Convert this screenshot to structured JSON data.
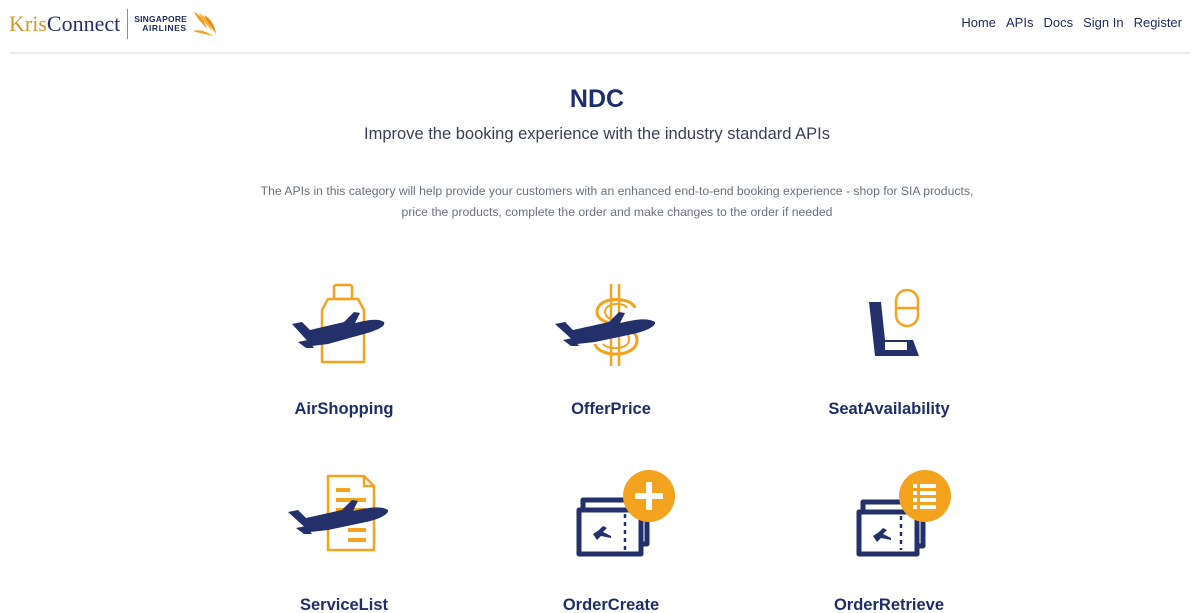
{
  "header": {
    "brand": {
      "prefix": "Kris",
      "suffix": "Connect"
    },
    "airline_logo": {
      "line1": "SINGAPORE",
      "line2": "AIRLINES"
    },
    "nav": [
      "Home",
      "APIs",
      "Docs",
      "Sign In",
      "Register"
    ]
  },
  "main": {
    "title": "NDC",
    "subtitle": "Improve the booking experience with the industry standard APIs",
    "description": "The APIs in this category will help provide your customers with an enhanced end-to-end booking experience - shop for SIA products, price the products, complete the order and make changes to the order if needed",
    "apis": [
      {
        "label": "AirShopping",
        "icon": "shopping-bag-plane-icon"
      },
      {
        "label": "OfferPrice",
        "icon": "dollar-plane-icon"
      },
      {
        "label": "SeatAvailability",
        "icon": "seat-icon"
      },
      {
        "label": "ServiceList",
        "icon": "document-plane-icon"
      },
      {
        "label": "OrderCreate",
        "icon": "ticket-plus-icon"
      },
      {
        "label": "OrderRetrieve",
        "icon": "ticket-list-icon"
      }
    ]
  },
  "colors": {
    "navy": "#23306a",
    "orange": "#f4a31f",
    "text": "#3a3f55"
  }
}
